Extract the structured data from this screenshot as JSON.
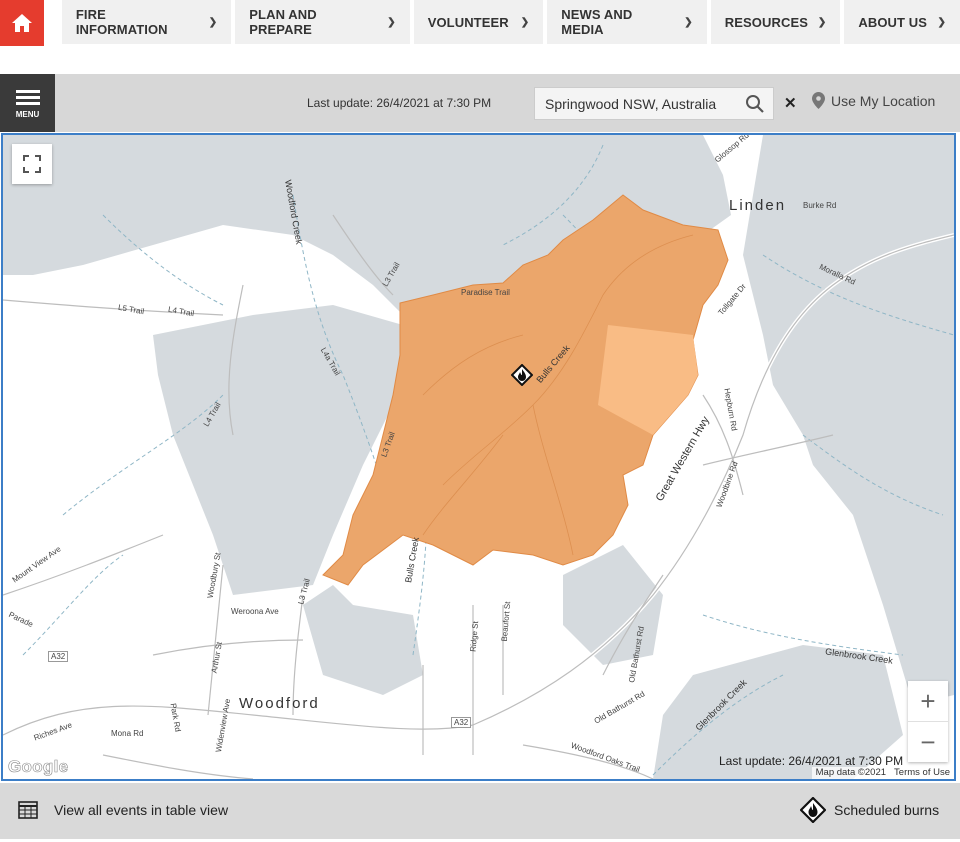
{
  "nav": {
    "home_icon": "home-icon",
    "items": [
      {
        "label": "FIRE INFORMATION"
      },
      {
        "label": "PLAN AND PREPARE"
      },
      {
        "label": "VOLUNTEER"
      },
      {
        "label": "NEWS AND MEDIA"
      },
      {
        "label": "RESOURCES"
      },
      {
        "label": "ABOUT US"
      }
    ]
  },
  "toolbar": {
    "menu_label": "MENU",
    "last_update": "Last update: 26/4/2021 at 7:30 PM",
    "search_value": "Springwood NSW, Australia",
    "clear_icon": "close-icon",
    "use_location": "Use My Location"
  },
  "map": {
    "towns": {
      "linden": "Linden",
      "woodford": "Woodford"
    },
    "roads": {
      "glossop": "Glossop Rd",
      "burke": "Burke Rd",
      "moralla": "Moralla Rd",
      "tollgate": "Tollgate Dr",
      "l5": "L5 Trail",
      "l4": "L4 Trail",
      "l3": "L3 Trail",
      "l4a": "L4a Trail",
      "l4b": "L4 Trail",
      "l3b": "L3 Trail",
      "l3c": "L3 Trail",
      "mountview": "Mount View Ave",
      "weroona": "Weroona Ave",
      "woodbury": "Woodbury St",
      "arthur": "Arthur St",
      "parade": "Parade",
      "a32a": "A32",
      "a32b": "A32",
      "riches": "Riches Ave",
      "mona": "Mona Rd",
      "park": "Park Rd",
      "wiltshire": "Widenview Ave",
      "ridge": "Ridge St",
      "beaufort": "Beaufort St",
      "oldbathurst1": "Old Bathurst Rd",
      "oldbathurst2": "Old Bathurst Rd",
      "woodfordoaks": "Woodford Oaks Trail",
      "hepburn": "Hepburn Rd",
      "woodbine": "Woodbine Rd",
      "paradise": "Paradise Trail",
      "gwh": "Great Western Hwy"
    },
    "creeks": {
      "woodford": "Woodford Creek",
      "bulls1": "Bulls Creek",
      "bulls2": "Bulls Creek",
      "glenbrook1": "Glenbrook Creek",
      "glenbrook2": "Glenbrook Creek"
    },
    "last_update": "Last update: 26/4/2021 at 7:30 PM",
    "attribution": {
      "data": "Map data ©2021",
      "terms": "Terms of Use"
    },
    "google": "Google",
    "zoom_in": "+",
    "zoom_out": "−",
    "colors": {
      "fire": "#eba66b",
      "fire_light": "#f9bc85",
      "bush": "#d5dade",
      "road": "#ffffff"
    }
  },
  "footer": {
    "table_view": "View all events in table view",
    "scheduled_burns": "Scheduled burns"
  }
}
